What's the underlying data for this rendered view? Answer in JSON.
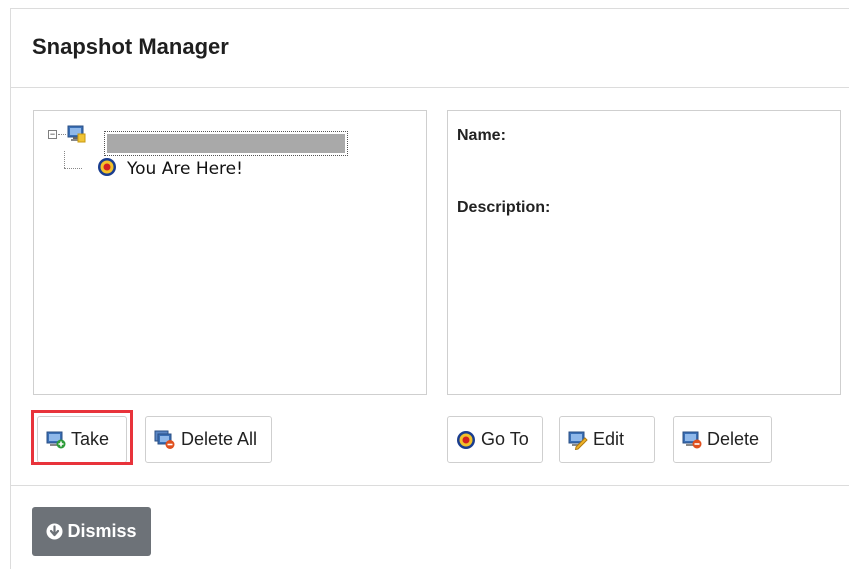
{
  "dialog": {
    "title": "Snapshot Manager"
  },
  "tree": {
    "root_toggle": "−",
    "root_icon": "vm-snapshot-icon",
    "current_label": "You Are Here!",
    "current_icon": "target-icon"
  },
  "details": {
    "name_label": "Name:",
    "description_label": "Description:"
  },
  "buttons": {
    "take": "Take",
    "delete_all": "Delete All",
    "go_to": "Go To",
    "edit": "Edit",
    "delete": "Delete",
    "dismiss": "Dismiss"
  },
  "colors": {
    "highlight": "#e8333b",
    "dismiss_bg": "#6d7278"
  }
}
